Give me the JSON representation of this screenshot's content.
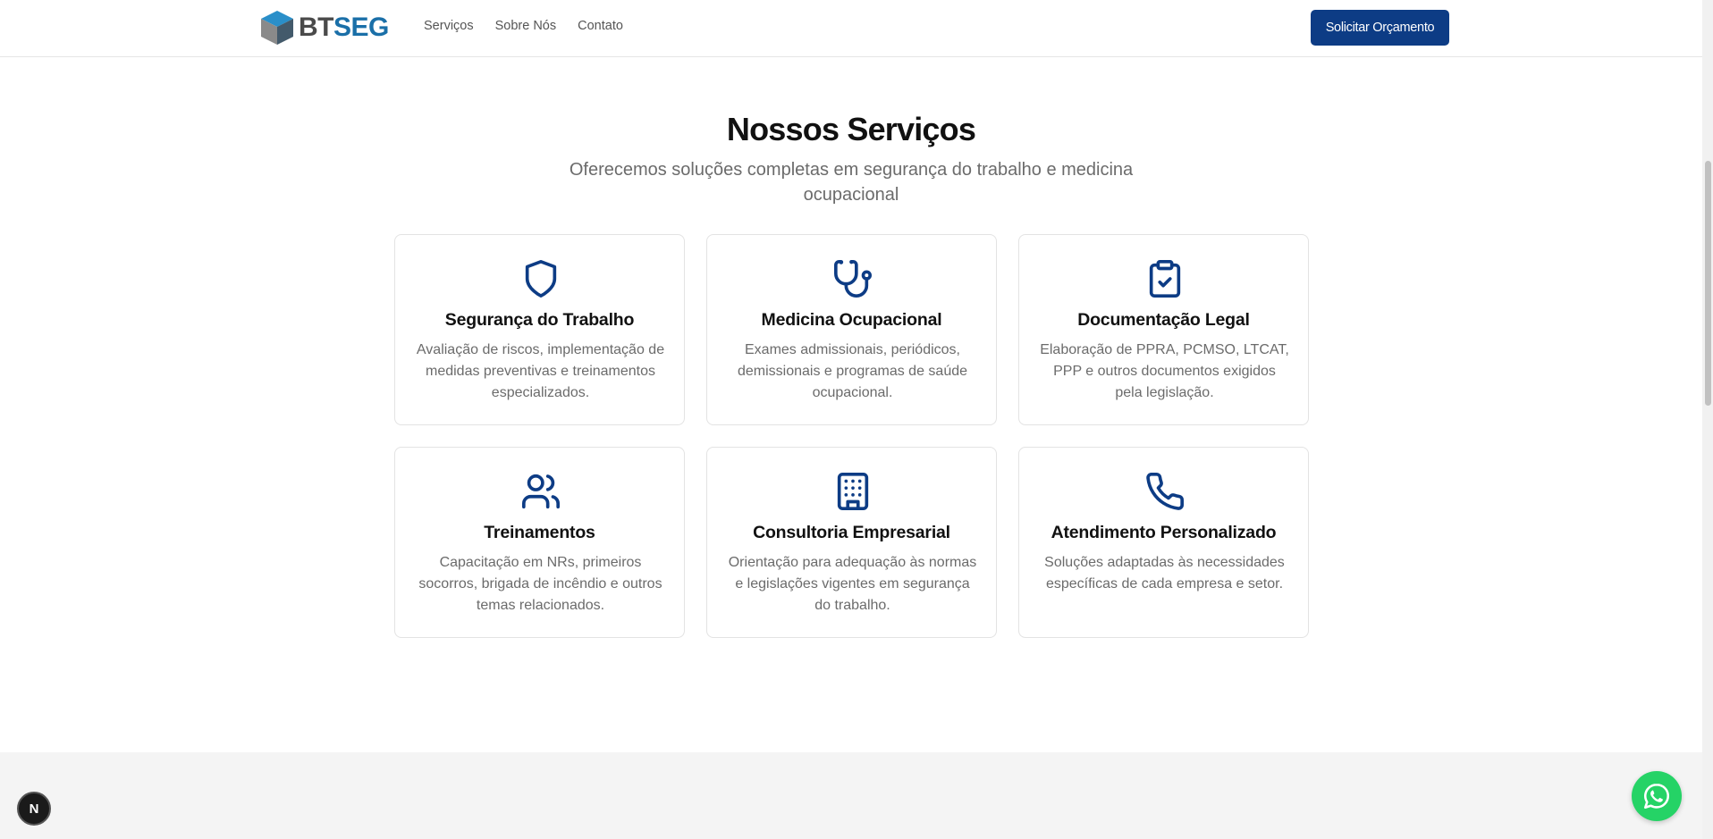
{
  "header": {
    "logo_bt": "BT",
    "logo_seg": "SEG",
    "nav": [
      "Serviços",
      "Sobre Nós",
      "Contato"
    ],
    "cta_label": "Solicitar Orçamento"
  },
  "section": {
    "title": "Nossos Serviços",
    "subtitle": "Oferecemos soluções completas em segurança do trabalho e medicina ocupacional"
  },
  "cards": [
    {
      "title": "Segurança do Trabalho",
      "desc": "Avaliação de riscos, implementação de medidas preventivas e treinamentos especializados.",
      "icon": "shield-icon"
    },
    {
      "title": "Medicina Ocupacional",
      "desc": "Exames admissionais, periódicos, demissionais e programas de saúde ocupacional.",
      "icon": "stethoscope-icon"
    },
    {
      "title": "Documentação Legal",
      "desc": "Elaboração de PPRA, PCMSO, LTCAT, PPP e outros documentos exigidos pela legislação.",
      "icon": "clipboard-check-icon"
    },
    {
      "title": "Treinamentos",
      "desc": "Capacitação em NRs, primeiros socorros, brigada de incêndio e outros temas relacionados.",
      "icon": "users-icon"
    },
    {
      "title": "Consultoria Empresarial",
      "desc": "Orientação para adequação às normas e legislações vigentes em segurança do trabalho.",
      "icon": "building-icon"
    },
    {
      "title": "Atendimento Personalizado",
      "desc": "Soluções adaptadas às necessidades específicas de cada empresa e setor.",
      "icon": "phone-icon"
    }
  ],
  "badge_letter": "N",
  "colors": {
    "primary": "#0d3c85",
    "logo_seg": "#1a6fa8",
    "whatsapp": "#25d366"
  }
}
